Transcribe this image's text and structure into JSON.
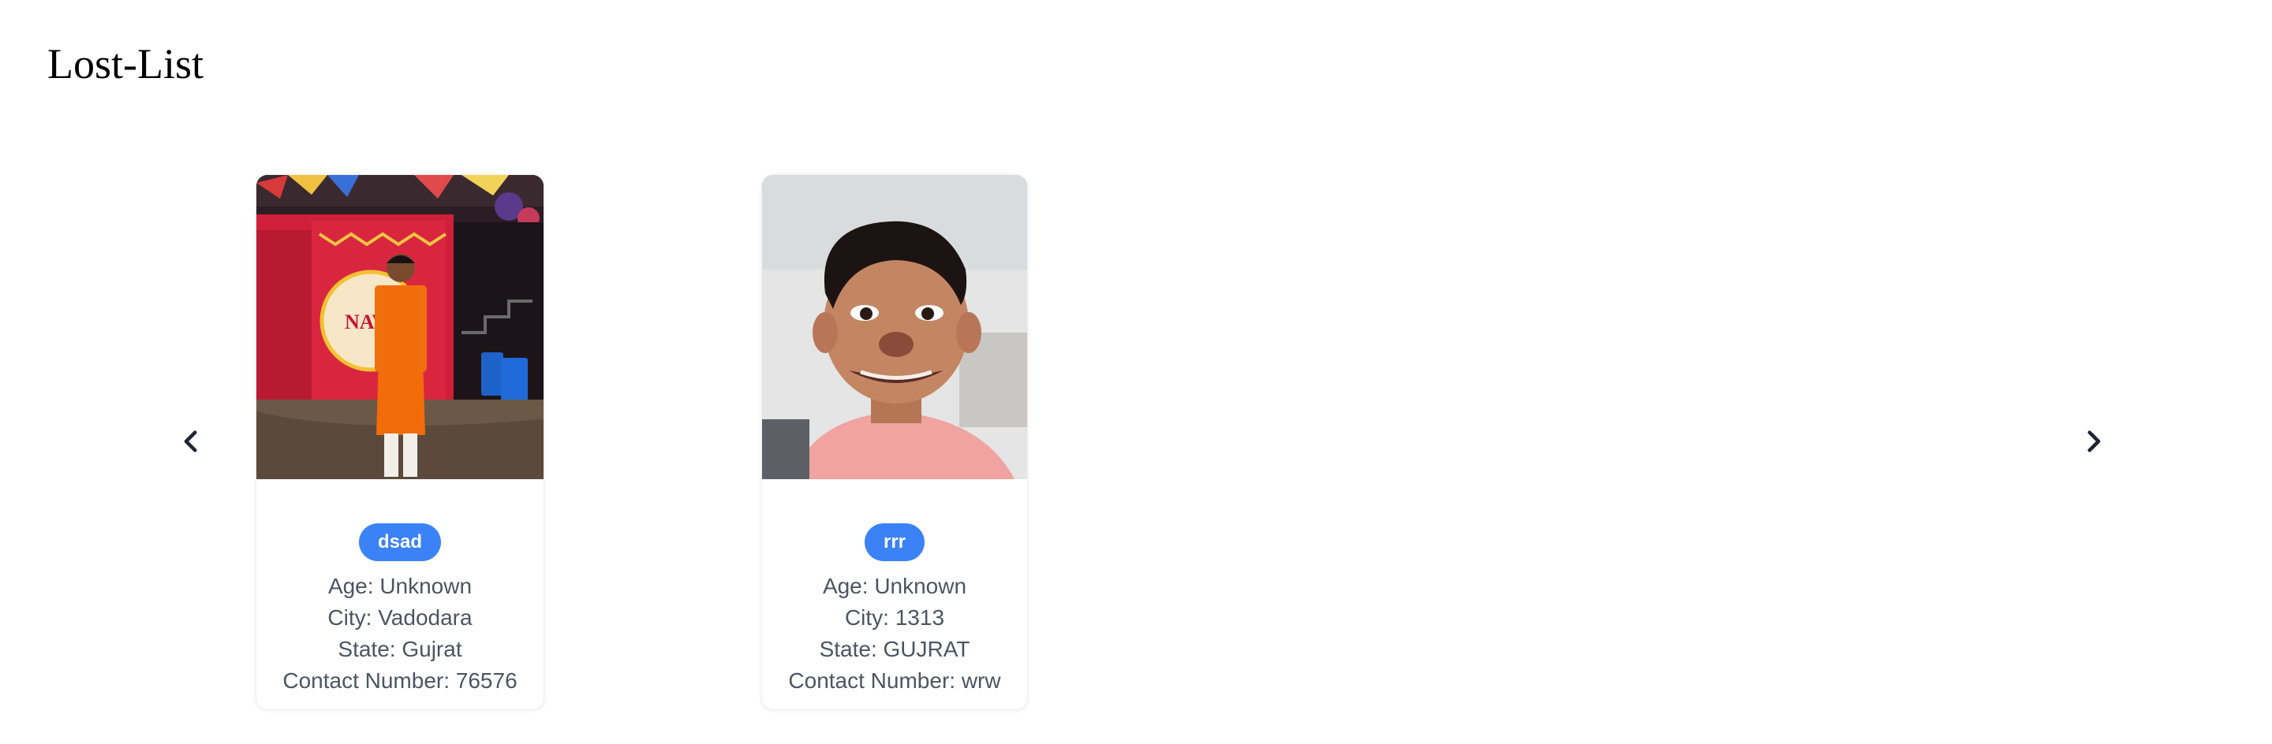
{
  "page": {
    "title": "Lost-List"
  },
  "carousel": {
    "prev_icon": "chevron-left-icon",
    "next_icon": "chevron-right-icon",
    "cards": [
      {
        "name": "dsad",
        "age": "Age: Unknown",
        "city": "City: Vadodara",
        "state": "State: Gujrat",
        "contact": "Contact Number: 76576",
        "photo": "person-photo"
      },
      {
        "name": "rrr",
        "age": "Age: Unknown",
        "city": "City: 1313",
        "state": "State: GUJRAT",
        "contact": "Contact Number: wrw",
        "photo": "person-photo"
      }
    ]
  },
  "colors": {
    "badge": "#3b82f6",
    "text": "#4b5563",
    "arrow": "#1f2433"
  }
}
